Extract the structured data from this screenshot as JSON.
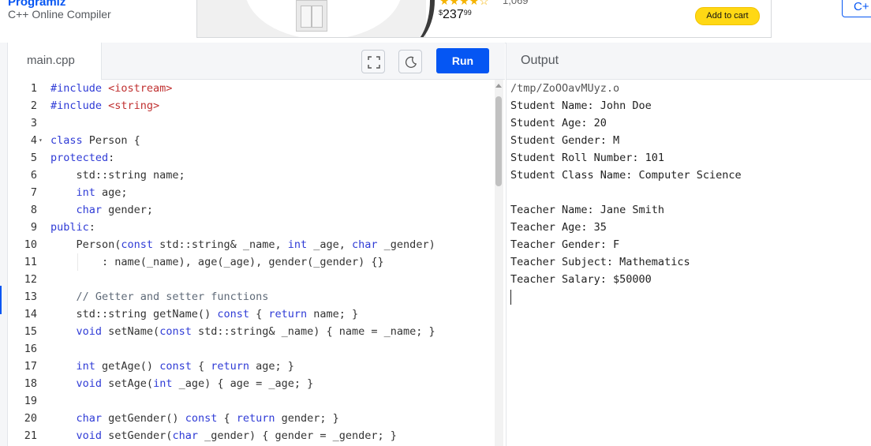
{
  "brand": {
    "title": "Programiz",
    "subtitle": "C++ Online Compiler",
    "corner_label": "C+"
  },
  "ad": {
    "stars": "★★★★☆",
    "reviews": "1,069",
    "currency": "$",
    "price_whole": "237",
    "price_cents": "99",
    "cart_label": "Add to cart"
  },
  "editor": {
    "file_name": "main.cpp",
    "run_label": "Run",
    "fullscreen_icon": "expand-icon",
    "theme_icon": "moon-icon",
    "lines": [
      {
        "n": "1",
        "fold": "",
        "tokens": [
          {
            "t": "kw",
            "v": "#include "
          },
          {
            "t": "str",
            "v": "<iostream>"
          }
        ]
      },
      {
        "n": "2",
        "fold": "",
        "tokens": [
          {
            "t": "kw",
            "v": "#include "
          },
          {
            "t": "str",
            "v": "<string>"
          }
        ]
      },
      {
        "n": "3",
        "fold": "",
        "tokens": []
      },
      {
        "n": "4",
        "fold": "▾",
        "tokens": [
          {
            "t": "kw",
            "v": "class"
          },
          {
            "t": "p",
            "v": " Person {"
          }
        ]
      },
      {
        "n": "5",
        "fold": "",
        "tokens": [
          {
            "t": "kw",
            "v": "protected"
          },
          {
            "t": "p",
            "v": ":"
          }
        ]
      },
      {
        "n": "6",
        "fold": "",
        "tokens": [
          {
            "t": "p",
            "v": "    std::string name;"
          }
        ]
      },
      {
        "n": "7",
        "fold": "",
        "tokens": [
          {
            "t": "p",
            "v": "    "
          },
          {
            "t": "kw",
            "v": "int"
          },
          {
            "t": "p",
            "v": " age;"
          }
        ]
      },
      {
        "n": "8",
        "fold": "",
        "tokens": [
          {
            "t": "p",
            "v": "    "
          },
          {
            "t": "kw",
            "v": "char"
          },
          {
            "t": "p",
            "v": " gender;"
          }
        ]
      },
      {
        "n": "9",
        "fold": "",
        "tokens": [
          {
            "t": "kw",
            "v": "public"
          },
          {
            "t": "p",
            "v": ":"
          }
        ]
      },
      {
        "n": "10",
        "fold": "",
        "tokens": [
          {
            "t": "p",
            "v": "    Person("
          },
          {
            "t": "kw",
            "v": "const"
          },
          {
            "t": "p",
            "v": " std::string& _name, "
          },
          {
            "t": "kw",
            "v": "int"
          },
          {
            "t": "p",
            "v": " _age, "
          },
          {
            "t": "kw",
            "v": "char"
          },
          {
            "t": "p",
            "v": " _gender)"
          }
        ]
      },
      {
        "n": "11",
        "fold": "",
        "tokens": [
          {
            "t": "p",
            "v": "        : name(_name), age(_age), gender(_gender) {}"
          }
        ]
      },
      {
        "n": "12",
        "fold": "",
        "tokens": []
      },
      {
        "n": "13",
        "fold": "",
        "tokens": [
          {
            "t": "p",
            "v": "    "
          },
          {
            "t": "cm",
            "v": "// Getter and setter functions"
          }
        ]
      },
      {
        "n": "14",
        "fold": "",
        "tokens": [
          {
            "t": "p",
            "v": "    std::string getName() "
          },
          {
            "t": "kw",
            "v": "const"
          },
          {
            "t": "p",
            "v": " { "
          },
          {
            "t": "kw",
            "v": "return"
          },
          {
            "t": "p",
            "v": " name; }"
          }
        ]
      },
      {
        "n": "15",
        "fold": "",
        "tokens": [
          {
            "t": "p",
            "v": "    "
          },
          {
            "t": "kw",
            "v": "void"
          },
          {
            "t": "p",
            "v": " setName("
          },
          {
            "t": "kw",
            "v": "const"
          },
          {
            "t": "p",
            "v": " std::string& _name) { name = _name; }"
          }
        ]
      },
      {
        "n": "16",
        "fold": "",
        "tokens": []
      },
      {
        "n": "17",
        "fold": "",
        "tokens": [
          {
            "t": "p",
            "v": "    "
          },
          {
            "t": "kw",
            "v": "int"
          },
          {
            "t": "p",
            "v": " getAge() "
          },
          {
            "t": "kw",
            "v": "const"
          },
          {
            "t": "p",
            "v": " { "
          },
          {
            "t": "kw",
            "v": "return"
          },
          {
            "t": "p",
            "v": " age; }"
          }
        ]
      },
      {
        "n": "18",
        "fold": "",
        "tokens": [
          {
            "t": "p",
            "v": "    "
          },
          {
            "t": "kw",
            "v": "void"
          },
          {
            "t": "p",
            "v": " setAge("
          },
          {
            "t": "kw",
            "v": "int"
          },
          {
            "t": "p",
            "v": " _age) { age = _age; }"
          }
        ]
      },
      {
        "n": "19",
        "fold": "",
        "tokens": []
      },
      {
        "n": "20",
        "fold": "",
        "tokens": [
          {
            "t": "p",
            "v": "    "
          },
          {
            "t": "kw",
            "v": "char"
          },
          {
            "t": "p",
            "v": " getGender() "
          },
          {
            "t": "kw",
            "v": "const"
          },
          {
            "t": "p",
            "v": " { "
          },
          {
            "t": "kw",
            "v": "return"
          },
          {
            "t": "p",
            "v": " gender; }"
          }
        ]
      },
      {
        "n": "21",
        "fold": "",
        "tokens": [
          {
            "t": "p",
            "v": "    "
          },
          {
            "t": "kw",
            "v": "void"
          },
          {
            "t": "p",
            "v": " setGender("
          },
          {
            "t": "kw",
            "v": "char"
          },
          {
            "t": "p",
            "v": " _gender) { gender = _gender; }"
          }
        ]
      }
    ]
  },
  "output": {
    "title": "Output",
    "path": "/tmp/ZoOOavMUyz.o",
    "lines": [
      "Student Name: John Doe",
      "Student Age: 20",
      "Student Gender: M",
      "Student Roll Number: 101",
      "Student Class Name: Computer Science",
      "",
      "Teacher Name: Jane Smith",
      "Teacher Age: 35",
      "Teacher Gender: F",
      "Teacher Subject: Mathematics",
      "Teacher Salary: $50000"
    ]
  },
  "colors": {
    "accent": "#0556f3",
    "keyword": "#2f3bd6",
    "string": "#c03030",
    "comment": "#5f6a78",
    "cart": "#ffd814"
  }
}
